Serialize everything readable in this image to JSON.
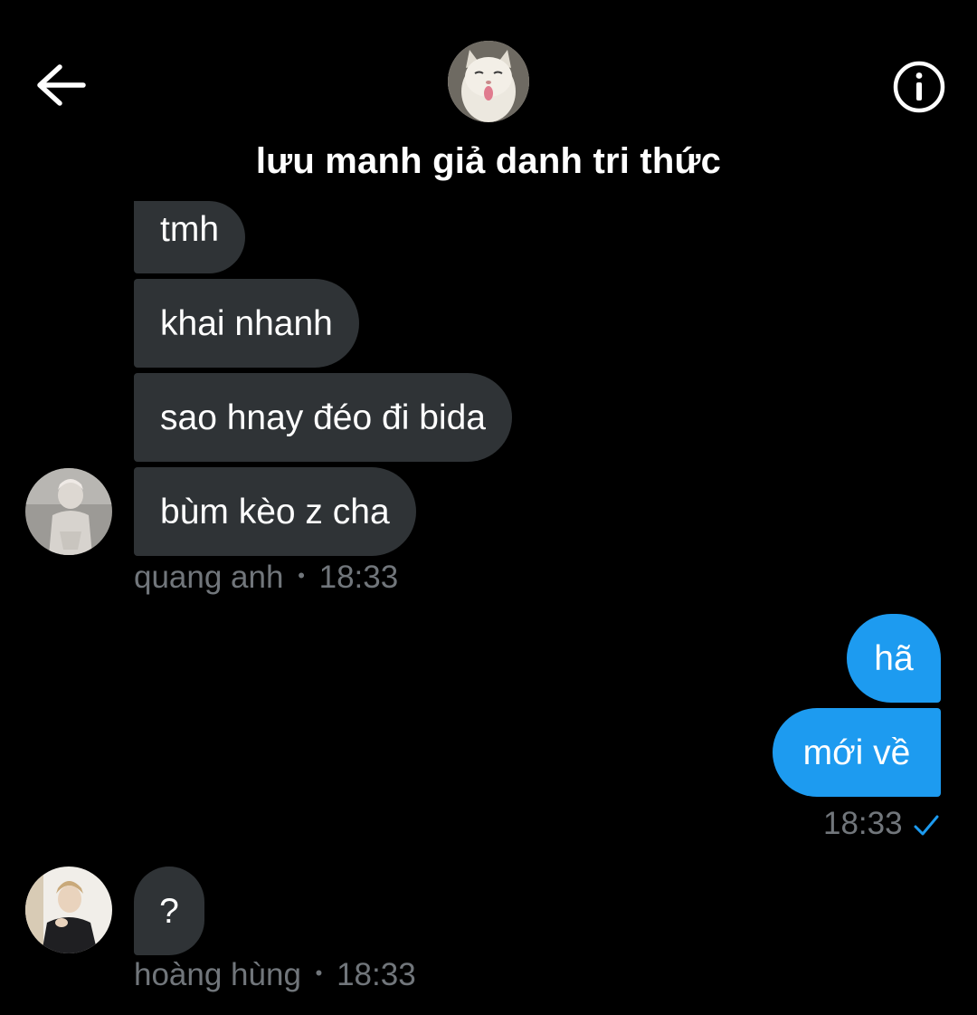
{
  "header": {
    "title": "lưu manh giả danh tri thức",
    "back_icon": "arrow-left-icon",
    "info_icon": "info-circle-icon"
  },
  "messages": {
    "group1": {
      "bubbles": [
        "tmh",
        "khai nhanh",
        "sao hnay đéo đi bida",
        "bùm kèo z cha"
      ],
      "sender": "quang anh",
      "separator": "•",
      "time": "18:33"
    },
    "group2": {
      "bubbles": [
        "hã",
        "mới về"
      ],
      "time": "18:33",
      "status_icon": "checkmark-sent-icon"
    },
    "group3": {
      "bubbles": [
        "?"
      ],
      "sender": "hoàng hùng",
      "separator": "•",
      "time": "18:33"
    }
  },
  "colors": {
    "background": "#000000",
    "incoming_bubble": "#2f3336",
    "outgoing_bubble": "#1d9bf0",
    "meta_text": "#71767b"
  }
}
